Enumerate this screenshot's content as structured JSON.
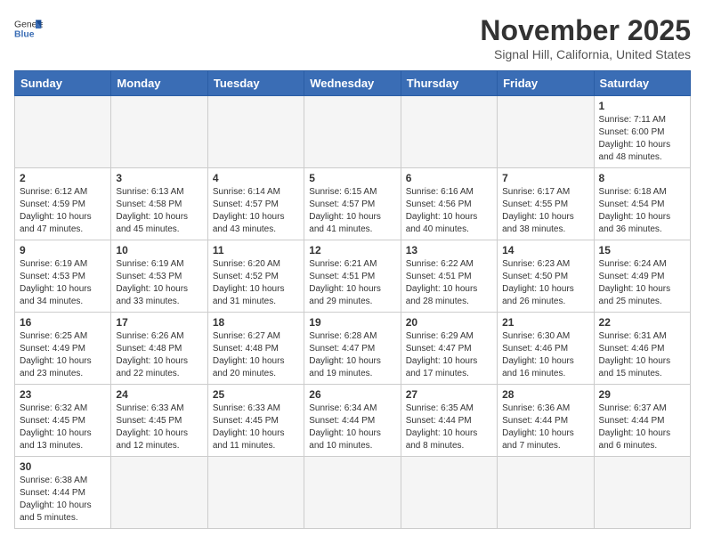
{
  "header": {
    "logo_text_regular": "General",
    "logo_text_bold": "Blue",
    "month_title": "November 2025",
    "location": "Signal Hill, California, United States"
  },
  "weekdays": [
    "Sunday",
    "Monday",
    "Tuesday",
    "Wednesday",
    "Thursday",
    "Friday",
    "Saturday"
  ],
  "weeks": [
    [
      {
        "day": "",
        "info": ""
      },
      {
        "day": "",
        "info": ""
      },
      {
        "day": "",
        "info": ""
      },
      {
        "day": "",
        "info": ""
      },
      {
        "day": "",
        "info": ""
      },
      {
        "day": "",
        "info": ""
      },
      {
        "day": "1",
        "info": "Sunrise: 7:11 AM\nSunset: 6:00 PM\nDaylight: 10 hours\nand 48 minutes."
      }
    ],
    [
      {
        "day": "2",
        "info": "Sunrise: 6:12 AM\nSunset: 4:59 PM\nDaylight: 10 hours\nand 47 minutes."
      },
      {
        "day": "3",
        "info": "Sunrise: 6:13 AM\nSunset: 4:58 PM\nDaylight: 10 hours\nand 45 minutes."
      },
      {
        "day": "4",
        "info": "Sunrise: 6:14 AM\nSunset: 4:57 PM\nDaylight: 10 hours\nand 43 minutes."
      },
      {
        "day": "5",
        "info": "Sunrise: 6:15 AM\nSunset: 4:57 PM\nDaylight: 10 hours\nand 41 minutes."
      },
      {
        "day": "6",
        "info": "Sunrise: 6:16 AM\nSunset: 4:56 PM\nDaylight: 10 hours\nand 40 minutes."
      },
      {
        "day": "7",
        "info": "Sunrise: 6:17 AM\nSunset: 4:55 PM\nDaylight: 10 hours\nand 38 minutes."
      },
      {
        "day": "8",
        "info": "Sunrise: 6:18 AM\nSunset: 4:54 PM\nDaylight: 10 hours\nand 36 minutes."
      }
    ],
    [
      {
        "day": "9",
        "info": "Sunrise: 6:19 AM\nSunset: 4:53 PM\nDaylight: 10 hours\nand 34 minutes."
      },
      {
        "day": "10",
        "info": "Sunrise: 6:19 AM\nSunset: 4:53 PM\nDaylight: 10 hours\nand 33 minutes."
      },
      {
        "day": "11",
        "info": "Sunrise: 6:20 AM\nSunset: 4:52 PM\nDaylight: 10 hours\nand 31 minutes."
      },
      {
        "day": "12",
        "info": "Sunrise: 6:21 AM\nSunset: 4:51 PM\nDaylight: 10 hours\nand 29 minutes."
      },
      {
        "day": "13",
        "info": "Sunrise: 6:22 AM\nSunset: 4:51 PM\nDaylight: 10 hours\nand 28 minutes."
      },
      {
        "day": "14",
        "info": "Sunrise: 6:23 AM\nSunset: 4:50 PM\nDaylight: 10 hours\nand 26 minutes."
      },
      {
        "day": "15",
        "info": "Sunrise: 6:24 AM\nSunset: 4:49 PM\nDaylight: 10 hours\nand 25 minutes."
      }
    ],
    [
      {
        "day": "16",
        "info": "Sunrise: 6:25 AM\nSunset: 4:49 PM\nDaylight: 10 hours\nand 23 minutes."
      },
      {
        "day": "17",
        "info": "Sunrise: 6:26 AM\nSunset: 4:48 PM\nDaylight: 10 hours\nand 22 minutes."
      },
      {
        "day": "18",
        "info": "Sunrise: 6:27 AM\nSunset: 4:48 PM\nDaylight: 10 hours\nand 20 minutes."
      },
      {
        "day": "19",
        "info": "Sunrise: 6:28 AM\nSunset: 4:47 PM\nDaylight: 10 hours\nand 19 minutes."
      },
      {
        "day": "20",
        "info": "Sunrise: 6:29 AM\nSunset: 4:47 PM\nDaylight: 10 hours\nand 17 minutes."
      },
      {
        "day": "21",
        "info": "Sunrise: 6:30 AM\nSunset: 4:46 PM\nDaylight: 10 hours\nand 16 minutes."
      },
      {
        "day": "22",
        "info": "Sunrise: 6:31 AM\nSunset: 4:46 PM\nDaylight: 10 hours\nand 15 minutes."
      }
    ],
    [
      {
        "day": "23",
        "info": "Sunrise: 6:32 AM\nSunset: 4:45 PM\nDaylight: 10 hours\nand 13 minutes."
      },
      {
        "day": "24",
        "info": "Sunrise: 6:33 AM\nSunset: 4:45 PM\nDaylight: 10 hours\nand 12 minutes."
      },
      {
        "day": "25",
        "info": "Sunrise: 6:33 AM\nSunset: 4:45 PM\nDaylight: 10 hours\nand 11 minutes."
      },
      {
        "day": "26",
        "info": "Sunrise: 6:34 AM\nSunset: 4:44 PM\nDaylight: 10 hours\nand 10 minutes."
      },
      {
        "day": "27",
        "info": "Sunrise: 6:35 AM\nSunset: 4:44 PM\nDaylight: 10 hours\nand 8 minutes."
      },
      {
        "day": "28",
        "info": "Sunrise: 6:36 AM\nSunset: 4:44 PM\nDaylight: 10 hours\nand 7 minutes."
      },
      {
        "day": "29",
        "info": "Sunrise: 6:37 AM\nSunset: 4:44 PM\nDaylight: 10 hours\nand 6 minutes."
      }
    ],
    [
      {
        "day": "30",
        "info": "Sunrise: 6:38 AM\nSunset: 4:44 PM\nDaylight: 10 hours\nand 5 minutes."
      },
      {
        "day": "",
        "info": ""
      },
      {
        "day": "",
        "info": ""
      },
      {
        "day": "",
        "info": ""
      },
      {
        "day": "",
        "info": ""
      },
      {
        "day": "",
        "info": ""
      },
      {
        "day": "",
        "info": ""
      }
    ]
  ]
}
